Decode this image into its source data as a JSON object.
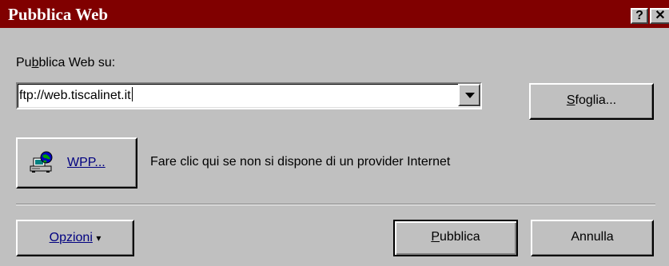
{
  "window": {
    "title": "Pubblica Web",
    "help_button": "?",
    "close_button": "✕"
  },
  "form": {
    "publish_label_pre": "Pu",
    "publish_label_key": "b",
    "publish_label_post": "blica Web su:",
    "url_value": "ftp://web.tiscalinet.it",
    "browse_key": "S",
    "browse_rest": "foglia..."
  },
  "wpp": {
    "button_key": "W",
    "button_rest": "PP...",
    "description": "Fare clic qui se non si dispone di un provider Internet",
    "icon": "wpp-globe-computer-icon"
  },
  "footer": {
    "options_key": "O",
    "options_rest": "pzioni",
    "options_arrow": "▾",
    "publish_key": "P",
    "publish_rest": "ubblica",
    "cancel_label": "Annulla"
  }
}
